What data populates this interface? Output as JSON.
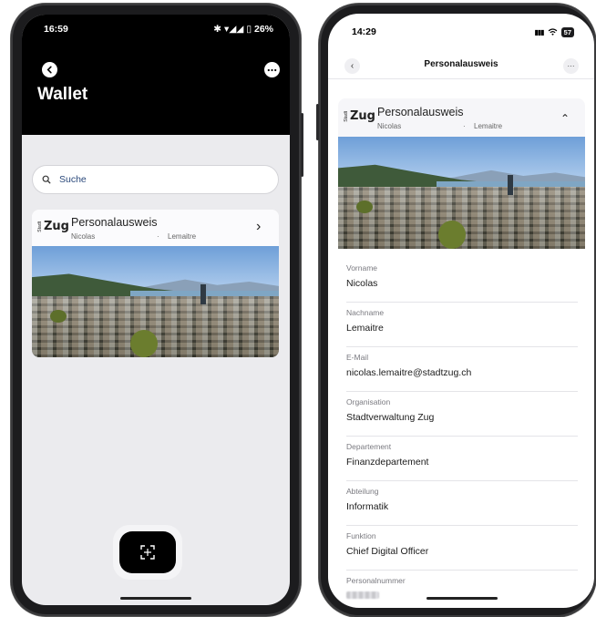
{
  "left": {
    "status": {
      "time": "16:59",
      "indicators": "✱ ▾◢◢ ▯ 26%"
    },
    "header": {
      "title": "Wallet",
      "back_icon": "back-arrow-icon",
      "menu_icon": "more-dots-icon"
    },
    "search": {
      "placeholder": "Suche",
      "icon": "search-icon"
    },
    "card": {
      "logo_small": "Stadt",
      "logo_big": "Zug",
      "title": "Personalausweis",
      "first_name": "Nicolas",
      "separator": "·",
      "last_name": "Lemaitre",
      "chevron": "›"
    },
    "scan_button": {
      "icon": "scan-icon"
    }
  },
  "right": {
    "status": {
      "time": "14:29",
      "signal": "▮▮▮",
      "wifi": "wifi-icon",
      "battery": "57"
    },
    "nav": {
      "title": "Personalausweis",
      "back_label": "‹",
      "menu_label": "···"
    },
    "card": {
      "logo_small": "Stadt",
      "logo_big": "Zug",
      "title": "Personalausweis",
      "first_name": "Nicolas",
      "separator": "·",
      "last_name": "Lemaitre",
      "chevron": "⌃"
    },
    "fields": [
      {
        "label": "Vorname",
        "value": "Nicolas"
      },
      {
        "label": "Nachname",
        "value": "Lemaitre"
      },
      {
        "label": "E-Mail",
        "value": "nicolas.lemaitre@stadtzug.ch"
      },
      {
        "label": "Organisation",
        "value": "Stadtverwaltung Zug"
      },
      {
        "label": "Departement",
        "value": "Finanzdepartement"
      },
      {
        "label": "Abteilung",
        "value": "Informatik"
      },
      {
        "label": "Funktion",
        "value": "Chief Digital Officer"
      },
      {
        "label": "Personalnummer",
        "value": ""
      }
    ]
  },
  "colors": {
    "header_bg": "#000000",
    "screen_bg": "#ebebee",
    "accent_text": "#2c4a7c"
  }
}
